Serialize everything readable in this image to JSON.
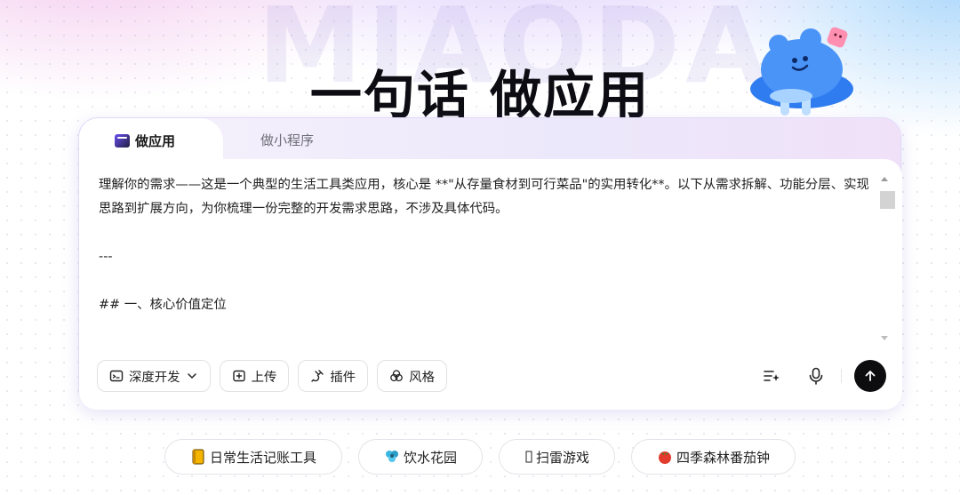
{
  "hero": {
    "watermark": "MIAODA",
    "title": "一句话 做应用"
  },
  "tabs": [
    {
      "label": "做应用",
      "active": true
    },
    {
      "label": "做小程序",
      "active": false
    }
  ],
  "editor": {
    "lines": [
      "理解你的需求——这是一个典型的生活工具类应用，核心是 **\"从存量食材到可行菜品\"的实用转化**。以下从需求拆解、功能分层、实现思路到扩展方向，为你梳理一份完整的开发需求思路，不涉及具体代码。",
      "",
      "---",
      "",
      "## 一、核心价值定位"
    ]
  },
  "toolbar": {
    "mode_label": "深度开发",
    "upload_label": "上传",
    "plugin_label": "插件",
    "style_label": "风格"
  },
  "suggestions": [
    {
      "label": "日常生活记账工具",
      "icon": "notebook-icon"
    },
    {
      "label": "饮水花园",
      "icon": "flower-icon"
    },
    {
      "label": "扫雷游戏",
      "icon": "box-glyph-icon"
    },
    {
      "label": "四季森林番茄钟",
      "icon": "tomato-icon"
    }
  ],
  "colors": {
    "accent": "#6b4cf2",
    "send_button": "#0d0d0f",
    "mascot": "#3f8cf7"
  }
}
